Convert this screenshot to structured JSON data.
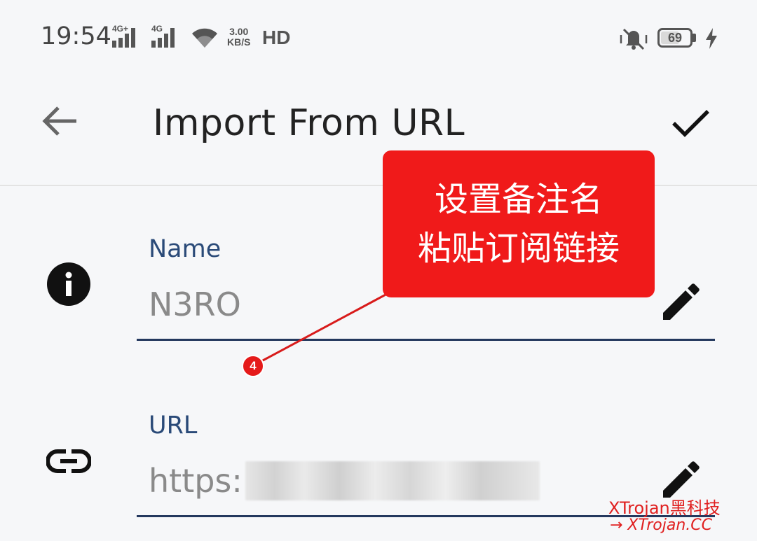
{
  "status_bar": {
    "time": "19:54",
    "signal1_label": "4G+",
    "signal2_label": "4G",
    "speed_value": "3.00",
    "speed_unit": "KB/S",
    "hd_label": "HD",
    "battery_level": "69",
    "battery_fraction": 0.69
  },
  "toolbar": {
    "title": "Import From URL",
    "back_icon": "arrow-left-icon",
    "confirm_icon": "check-icon"
  },
  "form": {
    "name": {
      "label": "Name",
      "value": "N3RO",
      "icon": "info-icon",
      "edit_icon": "pencil-icon"
    },
    "url": {
      "label": "URL",
      "value": "https:",
      "icon": "link-icon",
      "edit_icon": "pencil-icon"
    }
  },
  "annotation": {
    "line1": "设置备注名",
    "line2": "粘贴订阅链接",
    "step": "4"
  },
  "watermark": {
    "brand": "XTrojan黑科技",
    "site": "→ XTrojan.CC"
  },
  "colors": {
    "accent": "#24385e",
    "label": "#2a4a78",
    "callout": "#f01a1a",
    "background": "#f6f7f9"
  }
}
